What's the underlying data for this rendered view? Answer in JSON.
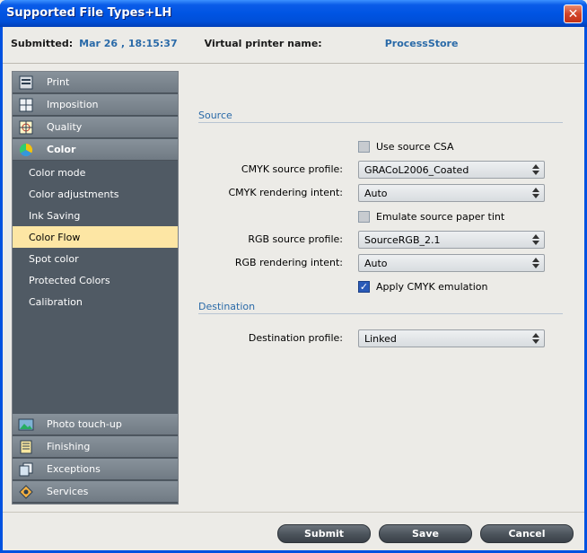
{
  "window": {
    "title": "Supported File Types+LH"
  },
  "info": {
    "submitted_label": "Submitted:",
    "submitted_value": "Mar 26 , 18:15:37",
    "printer_label": "Virtual printer name:",
    "printer_value": "ProcessStore"
  },
  "sidebar": {
    "top_sections": [
      {
        "label": "Print",
        "icon": "print-icon"
      },
      {
        "label": "Imposition",
        "icon": "imposition-icon"
      },
      {
        "label": "Quality",
        "icon": "quality-icon"
      },
      {
        "label": "Color",
        "icon": "color-wheel-icon"
      }
    ],
    "color_items": [
      "Color mode",
      "Color adjustments",
      "Ink Saving",
      "Color Flow",
      "Spot color",
      "Protected Colors",
      "Calibration"
    ],
    "selected_item": "Color Flow",
    "bottom_sections": [
      {
        "label": "Photo touch-up",
        "icon": "photo-icon"
      },
      {
        "label": "Finishing",
        "icon": "finishing-icon"
      },
      {
        "label": "Exceptions",
        "icon": "exceptions-icon"
      },
      {
        "label": "Services",
        "icon": "services-icon"
      }
    ]
  },
  "source": {
    "title": "Source",
    "use_csa": {
      "label": "Use source CSA",
      "checked": false
    },
    "cmyk_profile": {
      "label": "CMYK source profile:",
      "value": "GRACoL2006_Coated"
    },
    "cmyk_intent": {
      "label": "CMYK rendering intent:",
      "value": "Auto"
    },
    "paper_tint": {
      "label": "Emulate source paper tint",
      "checked": false
    },
    "rgb_profile": {
      "label": "RGB source profile:",
      "value": "SourceRGB_2.1"
    },
    "rgb_intent": {
      "label": "RGB rendering intent:",
      "value": "Auto"
    },
    "cmyk_emulation": {
      "label": "Apply CMYK emulation",
      "checked": true
    }
  },
  "destination": {
    "title": "Destination",
    "profile": {
      "label": "Destination profile:",
      "value": "Linked"
    }
  },
  "buttons": {
    "submit": "Submit",
    "save": "Save",
    "cancel": "Cancel"
  }
}
